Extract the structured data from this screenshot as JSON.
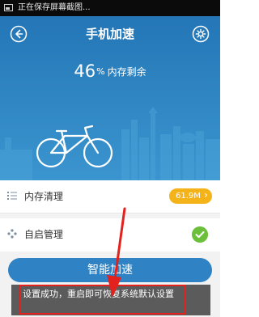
{
  "status_bar": {
    "text": "正在保存屏幕截图..."
  },
  "header": {
    "title": "手机加速",
    "back_icon": "back-arrow-icon",
    "settings_icon": "gear-icon"
  },
  "memory": {
    "value": "46",
    "unit": "%",
    "label": "内存剩余"
  },
  "list": {
    "items": [
      {
        "label": "内存清理",
        "icon": "list-icon",
        "badge": "61.9M",
        "badge_color": "#f5b31a"
      },
      {
        "label": "自启管理",
        "icon": "dots-icon",
        "status_icon": "check-icon",
        "status_color": "#6cbf3b"
      }
    ]
  },
  "actions": {
    "accelerate_label": "智能加速"
  },
  "toast": {
    "message": "设置成功，重启即可恢复系统默认设置"
  },
  "colors": {
    "primary": "#2a7fbd",
    "button": "#2f83c5",
    "accent": "#f5b31a",
    "success": "#6cbf3b",
    "highlight": "#e3211d"
  }
}
